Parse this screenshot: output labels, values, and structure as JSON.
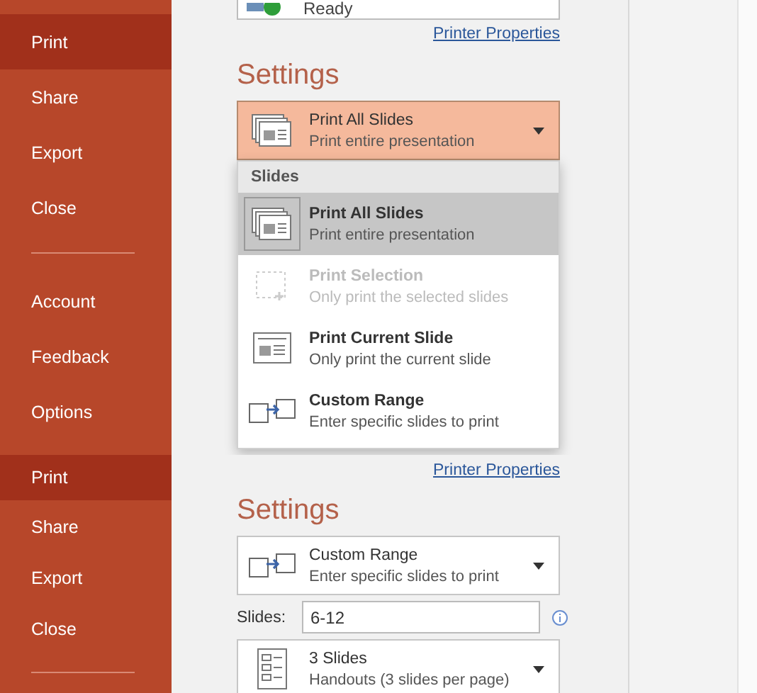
{
  "panels": [
    {
      "sidebar": {
        "items": [
          {
            "label": "Print",
            "selected": true,
            "divider_after": false
          },
          {
            "label": "Share",
            "selected": false,
            "divider_after": false
          },
          {
            "label": "Export",
            "selected": false,
            "divider_after": false
          },
          {
            "label": "Close",
            "selected": false,
            "divider_after": true
          },
          {
            "label": "Account",
            "selected": false,
            "divider_after": false
          },
          {
            "label": "Feedback",
            "selected": false,
            "divider_after": false
          },
          {
            "label": "Options",
            "selected": false,
            "divider_after": false
          }
        ]
      },
      "printer_status": "Ready",
      "printer_properties": "Printer Properties",
      "settings_title": "Settings",
      "dropdowns": [
        {
          "kind": "all",
          "title": "Print All Slides",
          "subtitle": "Print entire presentation",
          "open": true
        }
      ],
      "menu": {
        "header": "Slides",
        "items": [
          {
            "kind": "all",
            "title": "Print All Slides",
            "subtitle": "Print entire presentation",
            "selected": true,
            "disabled": false
          },
          {
            "kind": "selection",
            "title": "Print Selection",
            "subtitle": "Only print the selected slides",
            "selected": false,
            "disabled": true
          },
          {
            "kind": "current",
            "title": "Print Current Slide",
            "subtitle": "Only print the current slide",
            "selected": false,
            "disabled": false
          },
          {
            "kind": "custom",
            "title": "Custom Range",
            "subtitle": "Enter specific slides to print",
            "selected": false,
            "disabled": false
          }
        ]
      }
    },
    {
      "sidebar": {
        "items": [
          {
            "label": "Print",
            "selected": true,
            "divider_after": false
          },
          {
            "label": "Share",
            "selected": false,
            "divider_after": false
          },
          {
            "label": "Export",
            "selected": false,
            "divider_after": false
          },
          {
            "label": "Close",
            "selected": false,
            "divider_after": true
          }
        ]
      },
      "printer_properties": "Printer Properties",
      "settings_title": "Settings",
      "dropdowns": [
        {
          "kind": "custom",
          "title": "Custom Range",
          "subtitle": "Enter specific slides to print",
          "open": false
        },
        {
          "kind": "field",
          "label": "Slides:",
          "value": "6-12"
        },
        {
          "kind": "handouts",
          "title": "3 Slides",
          "subtitle": "Handouts (3 slides per page)",
          "open": false
        }
      ]
    }
  ]
}
